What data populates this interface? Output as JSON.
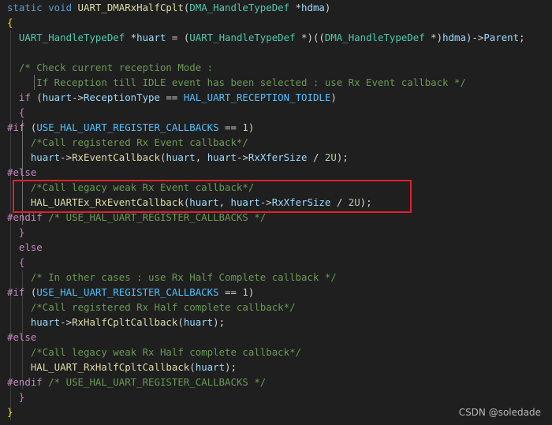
{
  "code_lines": [
    {
      "tokens": [
        [
          "static void ",
          "kw"
        ],
        [
          "UART_DMARxHalfCplt",
          "fn"
        ],
        [
          "(",
          "plain"
        ],
        [
          "DMA_HandleTypeDef",
          "type"
        ],
        [
          " *",
          "plain"
        ],
        [
          "hdma",
          "var"
        ],
        [
          ")",
          "plain"
        ]
      ]
    },
    {
      "tokens": [
        [
          "{",
          "brace1"
        ]
      ]
    },
    {
      "tokens": [
        [
          "  ",
          "plain"
        ],
        [
          "UART_HandleTypeDef",
          "type"
        ],
        [
          " *",
          "plain"
        ],
        [
          "huart",
          "var"
        ],
        [
          " = (",
          "plain"
        ],
        [
          "UART_HandleTypeDef",
          "type"
        ],
        [
          " *)((",
          "plain"
        ],
        [
          "DMA_HandleTypeDef",
          "type"
        ],
        [
          " *)",
          "plain"
        ],
        [
          "hdma",
          "var"
        ],
        [
          ")->",
          "plain"
        ],
        [
          "Parent",
          "var"
        ],
        [
          ";",
          "plain"
        ]
      ]
    },
    {
      "tokens": [
        [
          "",
          "plain"
        ]
      ]
    },
    {
      "tokens": [
        [
          "  /* Check current reception Mode :",
          "cmt"
        ]
      ]
    },
    {
      "tokens": [
        [
          "     If Reception till IDLE event has been selected : use Rx Event callback */",
          "cmt"
        ]
      ]
    },
    {
      "tokens": [
        [
          "  ",
          "plain"
        ],
        [
          "if",
          "ctl"
        ],
        [
          " (",
          "plain"
        ],
        [
          "huart",
          "var"
        ],
        [
          "->",
          "plain"
        ],
        [
          "ReceptionType",
          "var"
        ],
        [
          " == ",
          "plain"
        ],
        [
          "HAL_UART_RECEPTION_TOIDLE",
          "cst"
        ],
        [
          ")",
          "plain"
        ]
      ]
    },
    {
      "tokens": [
        [
          "  ",
          "plain"
        ],
        [
          "{",
          "brace2"
        ]
      ]
    },
    {
      "tokens": [
        [
          "#if",
          "pp"
        ],
        [
          " (",
          "plain"
        ],
        [
          "USE_HAL_UART_REGISTER_CALLBACKS",
          "cst"
        ],
        [
          " == ",
          "plain"
        ],
        [
          "1",
          "num"
        ],
        [
          ")",
          "plain"
        ]
      ]
    },
    {
      "tokens": [
        [
          "    /*Call registered Rx Event callback*/",
          "cmt"
        ]
      ]
    },
    {
      "tokens": [
        [
          "    ",
          "plain"
        ],
        [
          "huart",
          "var"
        ],
        [
          "->",
          "plain"
        ],
        [
          "RxEventCallback",
          "fn"
        ],
        [
          "(",
          "plain"
        ],
        [
          "huart",
          "var"
        ],
        [
          ", ",
          "plain"
        ],
        [
          "huart",
          "var"
        ],
        [
          "->",
          "plain"
        ],
        [
          "RxXferSize",
          "var"
        ],
        [
          " / ",
          "plain"
        ],
        [
          "2U",
          "num"
        ],
        [
          ");",
          "plain"
        ]
      ]
    },
    {
      "tokens": [
        [
          "#else",
          "pp"
        ]
      ]
    },
    {
      "tokens": [
        [
          "    /*Call legacy weak Rx Event callback*/",
          "cmt"
        ]
      ]
    },
    {
      "tokens": [
        [
          "    ",
          "plain"
        ],
        [
          "HAL_UARTEx_RxEventCallback",
          "fn"
        ],
        [
          "(",
          "plain"
        ],
        [
          "huart",
          "var"
        ],
        [
          ", ",
          "plain"
        ],
        [
          "huart",
          "var"
        ],
        [
          "->",
          "plain"
        ],
        [
          "RxXferSize",
          "var"
        ],
        [
          " / ",
          "plain"
        ],
        [
          "2U",
          "num"
        ],
        [
          ");",
          "plain"
        ]
      ]
    },
    {
      "tokens": [
        [
          "#endif",
          "pp"
        ],
        [
          " /* USE_HAL_UART_REGISTER_CALLBACKS */",
          "cmt"
        ]
      ]
    },
    {
      "tokens": [
        [
          "  ",
          "plain"
        ],
        [
          "}",
          "brace2"
        ]
      ]
    },
    {
      "tokens": [
        [
          "  ",
          "plain"
        ],
        [
          "else",
          "ctl"
        ]
      ]
    },
    {
      "tokens": [
        [
          "  ",
          "plain"
        ],
        [
          "{",
          "brace2"
        ]
      ]
    },
    {
      "tokens": [
        [
          "    /* In other cases : use Rx Half Complete callback */",
          "cmt"
        ]
      ]
    },
    {
      "tokens": [
        [
          "#if",
          "pp"
        ],
        [
          " (",
          "plain"
        ],
        [
          "USE_HAL_UART_REGISTER_CALLBACKS",
          "cst"
        ],
        [
          " == ",
          "plain"
        ],
        [
          "1",
          "num"
        ],
        [
          ")",
          "plain"
        ]
      ]
    },
    {
      "tokens": [
        [
          "    /*Call registered Rx Half complete callback*/",
          "cmt"
        ]
      ]
    },
    {
      "tokens": [
        [
          "    ",
          "plain"
        ],
        [
          "huart",
          "var"
        ],
        [
          "->",
          "plain"
        ],
        [
          "RxHalfCpltCallback",
          "fn"
        ],
        [
          "(",
          "plain"
        ],
        [
          "huart",
          "var"
        ],
        [
          ");",
          "plain"
        ]
      ]
    },
    {
      "tokens": [
        [
          "#else",
          "pp"
        ]
      ]
    },
    {
      "tokens": [
        [
          "    /*Call legacy weak Rx Half complete callback*/",
          "cmt"
        ]
      ]
    },
    {
      "tokens": [
        [
          "    ",
          "plain"
        ],
        [
          "HAL_UART_RxHalfCpltCallback",
          "fn"
        ],
        [
          "(",
          "plain"
        ],
        [
          "huart",
          "var"
        ],
        [
          ");",
          "plain"
        ]
      ]
    },
    {
      "tokens": [
        [
          "#endif",
          "pp"
        ],
        [
          " /* USE_HAL_UART_REGISTER_CALLBACKS */",
          "cmt"
        ]
      ]
    },
    {
      "tokens": [
        [
          "  ",
          "plain"
        ],
        [
          "}",
          "brace2"
        ]
      ]
    },
    {
      "tokens": [
        [
          "}",
          "brace1"
        ]
      ]
    }
  ],
  "watermark": "CSDN @soledade",
  "colors": {
    "background": "#1f1f1f",
    "highlight_border": "#e0202a"
  }
}
